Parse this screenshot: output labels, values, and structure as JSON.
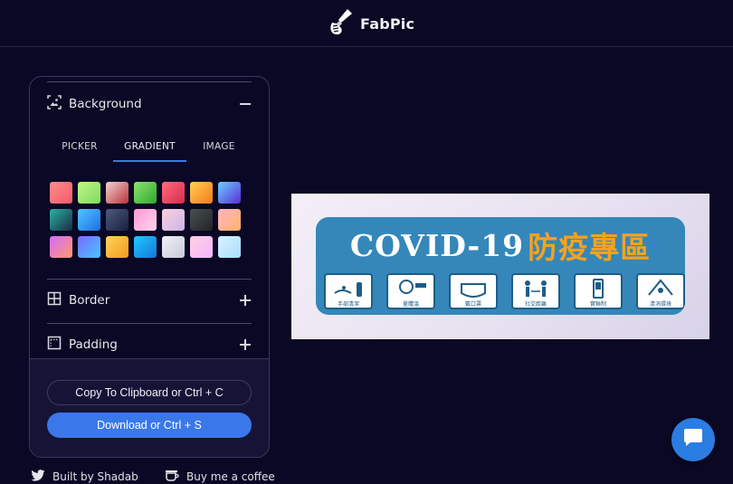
{
  "app": {
    "name": "FabPic"
  },
  "panel": {
    "background": {
      "label": "Background",
      "tabs": [
        {
          "label": "PICKER",
          "active": false
        },
        {
          "label": "GRADIENT",
          "active": true
        },
        {
          "label": "IMAGE",
          "active": false
        }
      ],
      "gradients": [
        [
          "#ff8a8a",
          "#f35b6b"
        ],
        [
          "#c3f58a",
          "#7ddc5a"
        ],
        [
          "#f2d2cf",
          "#b8323a"
        ],
        [
          "#8ee36b",
          "#2ea82e"
        ],
        [
          "#ff6a7d",
          "#d62c4a"
        ],
        [
          "#ffce55",
          "#f37b1a"
        ],
        [
          "#6ad0ff",
          "#5a2bd8"
        ],
        [
          "#29b3a1",
          "#1b2a45"
        ],
        [
          "#4fc7ff",
          "#1e6fe6"
        ],
        [
          "#4b5b80",
          "#1a1f3a"
        ],
        [
          "#ff9ad5",
          "#ffd3ec"
        ],
        [
          "#fbd0dc",
          "#cdb3e8"
        ],
        [
          "#4a4f52",
          "#202426"
        ],
        [
          "#ffb4c2",
          "#ffb36b"
        ],
        [
          "#d36bff",
          "#ff9a6b"
        ],
        [
          "#7b6bff",
          "#47c6ff"
        ],
        [
          "#ffd25a",
          "#f29b1d"
        ],
        [
          "#1fc9ff",
          "#1676d9"
        ],
        [
          "#eef0f6",
          "#c8ccd8"
        ],
        [
          "#ffd0e2",
          "#f4b6ff"
        ],
        [
          "#d8f2ff",
          "#a9dcff"
        ]
      ]
    },
    "border": {
      "label": "Border"
    },
    "padding": {
      "label": "Padding"
    },
    "copy_button": "Copy To Clipboard or Ctrl + C",
    "download_button": "Download or Ctrl + S"
  },
  "footer": {
    "built_by": "Built by Shadab",
    "coffee": "Buy me a coffee"
  },
  "preview": {
    "title_latin": "COVID-19",
    "title_cjk": "防疫專區",
    "tiles": [
      "手部清潔",
      "量體溫",
      "戴口罩",
      "社交距離",
      "實聯制",
      "清消環境"
    ]
  },
  "colors": {
    "background": "#0a0824",
    "accent": "#3a78ea",
    "banner": "#3587b9",
    "banner_highlight": "#f5a21f"
  }
}
